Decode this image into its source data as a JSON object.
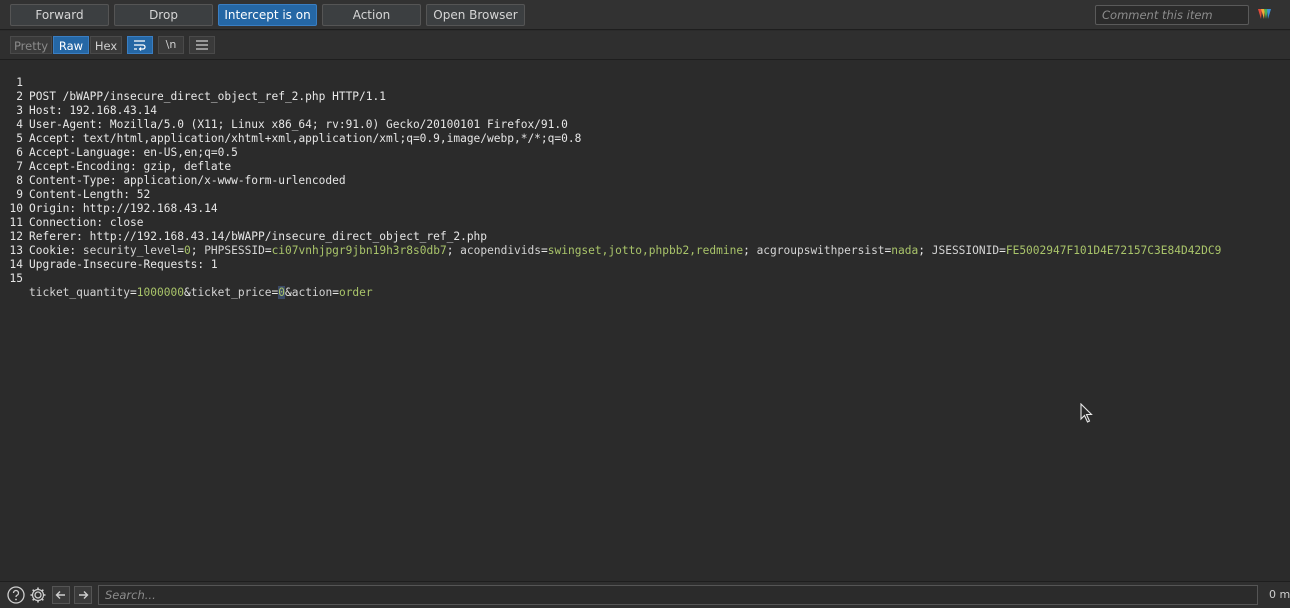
{
  "toolbar": {
    "forward": "Forward",
    "drop": "Drop",
    "intercept": "Intercept is on",
    "action": "Action",
    "open_browser": "Open Browser",
    "comment_placeholder": "Comment this item"
  },
  "view_tabs": {
    "pretty": "Pretty",
    "raw": "Raw",
    "hex": "Hex",
    "newline": "\\n",
    "active": "Raw"
  },
  "request": {
    "lines": [
      {
        "n": "1",
        "name": "POST /bWAPP/insecure_direct_object_ref_2.php HTTP/1.1",
        "value": ""
      },
      {
        "n": "2",
        "name": "Host",
        "value": "192.168.43.14"
      },
      {
        "n": "3",
        "name": "User-Agent",
        "value": "Mozilla/5.0 (X11; Linux x86_64; rv:91.0) Gecko/20100101 Firefox/91.0"
      },
      {
        "n": "4",
        "name": "Accept",
        "value": "text/html,application/xhtml+xml,application/xml;q=0.9,image/webp,*/*;q=0.8"
      },
      {
        "n": "5",
        "name": "Accept-Language",
        "value": "en-US,en;q=0.5"
      },
      {
        "n": "6",
        "name": "Accept-Encoding",
        "value": "gzip, deflate"
      },
      {
        "n": "7",
        "name": "Content-Type",
        "value": "application/x-www-form-urlencoded"
      },
      {
        "n": "8",
        "name": "Content-Length",
        "value": "52"
      },
      {
        "n": "9",
        "name": "Origin",
        "value": "http://192.168.43.14"
      },
      {
        "n": "10",
        "name": "Connection",
        "value": "close"
      },
      {
        "n": "11",
        "name": "Referer",
        "value": "http://192.168.43.14/bWAPP/insecure_direct_object_ref_2.php"
      },
      {
        "n": "12",
        "name": "Cookie",
        "value": ""
      },
      {
        "n": "13",
        "name": "Upgrade-Insecure-Requests",
        "value": "1"
      },
      {
        "n": "14",
        "name": "",
        "value": ""
      },
      {
        "n": "15",
        "name": "",
        "value": ""
      }
    ],
    "cookie": [
      {
        "name": "security_level",
        "value": "0"
      },
      {
        "name": "PHPSESSID",
        "value": "ci07vnhjpgr9jbn19h3r8s0db7"
      },
      {
        "name": "acopendivids",
        "value": "swingset,jotto,phpbb2,redmine"
      },
      {
        "name": "acgroupswithpersist",
        "value": "nada"
      },
      {
        "name": "JSESSIONID",
        "value": "FE5002947F101D4E72157C3E84D42DC9"
      }
    ],
    "body": [
      {
        "name": "ticket_quantity",
        "value": "1000000"
      },
      {
        "name": "ticket_price",
        "value": "0"
      },
      {
        "name": "action",
        "value": "order"
      }
    ]
  },
  "statusbar": {
    "search_placeholder": "Search...",
    "matches": "0 m"
  },
  "icons": {
    "help": "help-icon",
    "settings": "gear-icon",
    "back": "arrow-left-icon",
    "forward": "arrow-right-icon",
    "wrap": "wrap-lines-icon",
    "menu": "hamburger-menu-icon",
    "burp": "burp-logo-icon"
  },
  "colors": {
    "accent": "#2567a5",
    "param_value": "#a9c46a",
    "background": "#2b2b2b"
  }
}
